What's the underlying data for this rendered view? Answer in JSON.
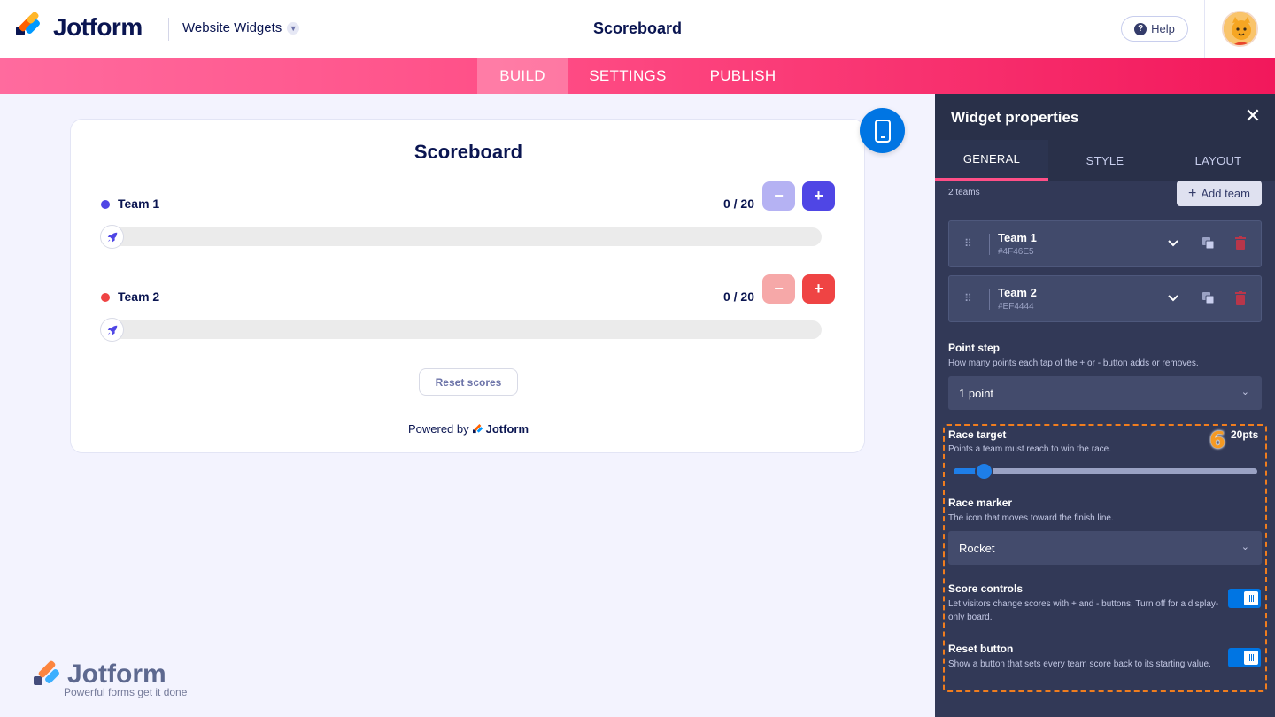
{
  "header": {
    "brand": "Jotform",
    "product": "Website Widgets",
    "page_title": "Scoreboard",
    "help_label": "Help"
  },
  "nav": {
    "tabs": [
      {
        "label": "BUILD",
        "active": true
      },
      {
        "label": "SETTINGS",
        "active": false
      },
      {
        "label": "PUBLISH",
        "active": false
      }
    ]
  },
  "widget": {
    "title": "Scoreboard",
    "teams": [
      {
        "name": "Team 1",
        "color": "#4F46E5",
        "score": "0 / 20",
        "progress": 0,
        "minus_color": "#b5b2f3",
        "plus_color": "#4F46E5"
      },
      {
        "name": "Team 2",
        "color": "#EF4444",
        "score": "0 / 20",
        "progress": 0,
        "minus_color": "#f6a8a8",
        "plus_color": "#EF4444"
      }
    ],
    "minus_label": "−",
    "plus_label": "+",
    "reset_label": "Reset scores",
    "powered_by": "Powered by",
    "powered_brand": "Jotform",
    "marker_icon": "rocket-icon"
  },
  "watermark": {
    "brand": "Jotform",
    "tagline": "Powerful forms get it done"
  },
  "panel": {
    "title": "Widget properties",
    "tabs": [
      {
        "label": "GENERAL",
        "active": true
      },
      {
        "label": "STYLE",
        "active": false
      },
      {
        "label": "LAYOUT",
        "active": false
      }
    ],
    "teams_count": "2 teams",
    "add_team_label": "Add team",
    "team_cards": [
      {
        "name": "Team 1",
        "color_hex": "#4F46E5"
      },
      {
        "name": "Team 2",
        "color_hex": "#EF4444"
      }
    ],
    "point_step": {
      "label": "Point step",
      "desc": "How many points each tap of the + or - button adds or removes.",
      "value": "1 point"
    },
    "race_target": {
      "label": "Race target",
      "desc": "Points a team must reach to win the race.",
      "value_label": "20pts",
      "slider_fraction": 0.1
    },
    "race_marker": {
      "label": "Race marker",
      "desc": "The icon that moves toward the finish line.",
      "value": "Rocket"
    },
    "score_controls": {
      "label": "Score controls",
      "desc": "Let visitors change scores with + and - buttons. Turn off for a display-only board.",
      "on": true
    },
    "reset_button": {
      "label": "Reset button",
      "desc": "Show a button that sets every team score back to its starting value.",
      "on": true
    },
    "annotation_number": "6"
  },
  "colors": {
    "accent_blue": "#0075e3",
    "brand_pink": "#ff4f87",
    "highlight_orange": "#f07d1e"
  }
}
